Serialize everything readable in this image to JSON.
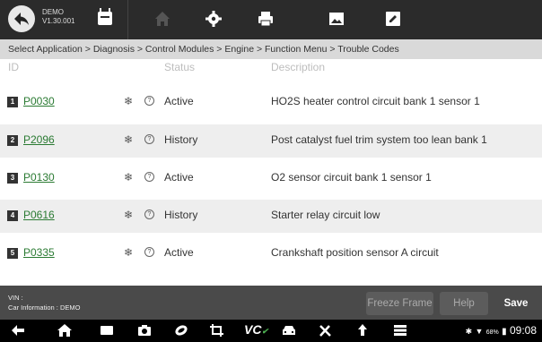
{
  "header": {
    "app_name": "DEMO",
    "version": "V1.30.001",
    "icons": [
      "back-icon",
      "car-icon",
      "home-icon",
      "gear-icon",
      "print-icon",
      "image-icon",
      "edit-icon"
    ]
  },
  "breadcrumb": "Select Application > Diagnosis > Control Modules > Engine > Function Menu > Trouble Codes",
  "table": {
    "columns": [
      "ID",
      "Status",
      "Description"
    ],
    "rows": [
      {
        "index": "1",
        "code": "P0030",
        "status": "Active",
        "description": "HO2S heater control circuit bank 1  sensor 1"
      },
      {
        "index": "2",
        "code": "P2096",
        "status": "History",
        "description": "Post catalyst fuel trim system too lean bank 1"
      },
      {
        "index": "3",
        "code": "P0130",
        "status": "Active",
        "description": "O2 sensor circuit bank 1 sensor 1"
      },
      {
        "index": "4",
        "code": "P0616",
        "status": "History",
        "description": "Starter relay circuit low"
      },
      {
        "index": "5",
        "code": "P0335",
        "status": "Active",
        "description": "Crankshaft position sensor A circuit"
      }
    ]
  },
  "footer": {
    "vin_label": "VIN :",
    "car_info": "Car Information : DEMO",
    "freeze_frame": "Freeze Frame",
    "help": "Help",
    "save": "Save"
  },
  "navbar": {
    "vc_label": "VC",
    "battery": "68%",
    "time": "09:08"
  },
  "colors": {
    "code_link": "#2a7a32",
    "topbar": "#2b2b2b",
    "footer": "#4a4a4a"
  }
}
